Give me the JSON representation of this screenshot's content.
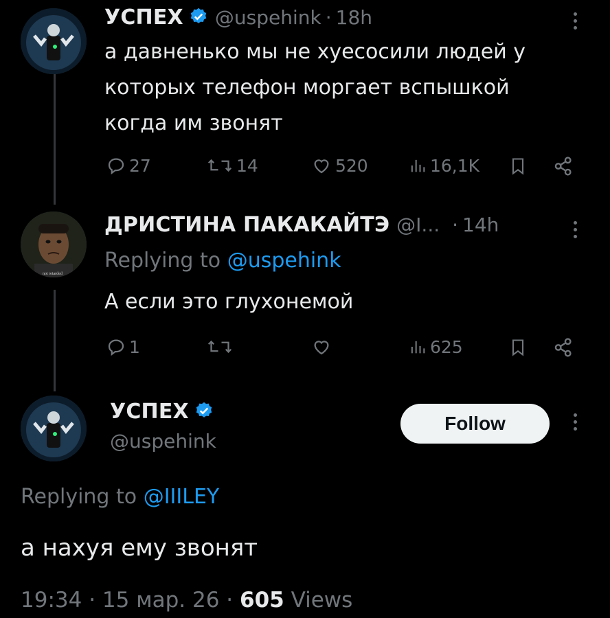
{
  "tweet1": {
    "display_name": "УСПЕХ",
    "handle": "@uspehink",
    "separator": "·",
    "time": "18h",
    "text_lines": [
      "а давненько мы не хуесосили людей у",
      "которых телефон моргает вспышкой",
      "когда им звонят"
    ],
    "reply_count": "27",
    "retweet_count": "14",
    "like_count": "520",
    "view_count": "16,1K"
  },
  "tweet2": {
    "display_name": "ДРИСТИНА ПАКАКАЙТЭ",
    "handle": "@I...",
    "separator": "·",
    "time": "14h",
    "avatar_caption": "not retarded",
    "replying_prefix": "Replying to",
    "replying_to": "@uspehink",
    "text": "А если это глухонемой",
    "reply_count": "1",
    "view_count": "625"
  },
  "main_tweet": {
    "display_name": "УСПЕХ",
    "handle": "@uspehink",
    "follow_label": "Follow",
    "replying_prefix": "Replying to",
    "replying_to": "@IIILEY",
    "text": "а нахуя ему звонят",
    "timestamp": "19:34",
    "date": "15 мар. 26",
    "separator": "·",
    "views_count": "605",
    "views_label": "Views"
  },
  "colors": {
    "background": "#000000",
    "text": "#e7e9ea",
    "muted": "#71767b",
    "accent": "#1d9bf0",
    "verified": "#1d9bf0"
  }
}
